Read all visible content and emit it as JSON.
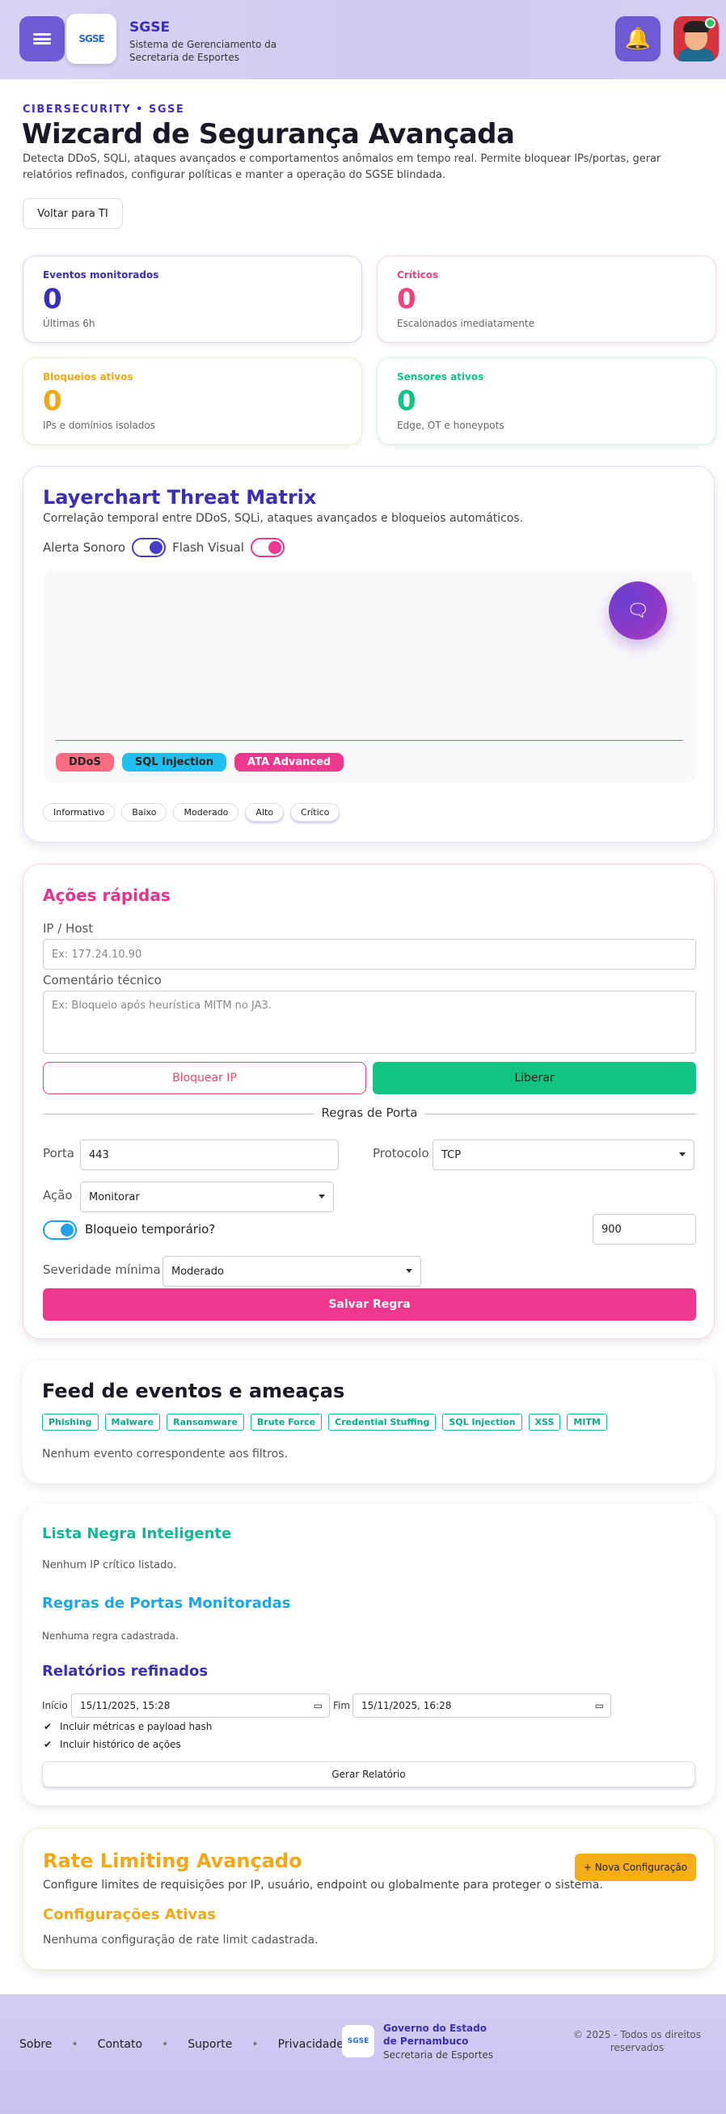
{
  "header": {
    "app_name": "SGSE",
    "app_subtitle": "Sistema de Gerenciamento da Secretaria de Esportes",
    "logo_text": "SGSE"
  },
  "hero": {
    "kicker": "CIBERSECURITY • SGSE",
    "title": "Wizcard de Segurança Avançada",
    "description": "Detecta DDoS, SQLi, ataques avançados e comportamentos anômalos em tempo real. Permite bloquear IPs/portas, gerar relatórios refinados, configurar políticas e manter a operação do SGSE blindada.",
    "back_label": "Voltar para TI"
  },
  "stats": [
    {
      "label": "Eventos monitorados",
      "value": "0",
      "sub": "Últimas 6h",
      "color": "#3b2fb8"
    },
    {
      "label": "Críticos",
      "value": "0",
      "sub": "Escalonados imediatamente",
      "color": "#f0457a"
    },
    {
      "label": "Bloqueios ativos",
      "value": "0",
      "sub": "IPs e domínios isolados",
      "color": "#f0a818"
    },
    {
      "label": "Sensores ativos",
      "value": "0",
      "sub": "Edge, OT e honeypots",
      "color": "#12c483"
    }
  ],
  "layerchart": {
    "title": "Layerchart Threat Matrix",
    "description": "Correlação temporal entre DDoS, SQLi, ataques avançados e bloqueios automáticos.",
    "alert_sound_label": "Alerta Sonoro",
    "flash_visual_label": "Flash Visual",
    "alert_sound_on": true,
    "flash_visual_on": true,
    "legend": [
      {
        "name": "DDoS",
        "color": "#ff6b81"
      },
      {
        "name": "SQL Injection",
        "color": "#1ec0f0"
      },
      {
        "name": "ATA Advanced",
        "color": "#f0378e"
      }
    ],
    "severity_filters": [
      "Informativo",
      "Baixo",
      "Moderado",
      "Alto",
      "Crítico"
    ]
  },
  "quick_actions": {
    "title": "Ações rápidas",
    "ip_label": "IP / Host",
    "ip_placeholder": "Ex: 177.24.10.90",
    "comment_label": "Comentário técnico",
    "comment_placeholder": "Ex: Bloqueio após heurística MITM no JA3.",
    "block_label": "Bloquear IP",
    "release_label": "Liberar",
    "port_rules_label": "Regras de Porta",
    "port_label": "Porta",
    "port_value": "443",
    "protocol_label": "Protocolo",
    "protocol_value": "TCP",
    "action_label": "Ação",
    "action_value": "Monitorar",
    "temp_block_label": "Bloqueio temporário?",
    "temp_block_on": true,
    "temp_block_value": "900",
    "min_severity_label": "Severidade mínima",
    "min_severity_value": "Moderado",
    "save_label": "Salvar Regra"
  },
  "feed": {
    "title": "Feed de eventos e ameaças",
    "tags": [
      "Phishing",
      "Malware",
      "Ransomware",
      "Brute Force",
      "Credential Stuffing",
      "SQL Injection",
      "XSS",
      "MITM"
    ],
    "empty": "Nenhum evento correspondente aos filtros."
  },
  "lists": {
    "blacklist_title": "Lista Negra Inteligente",
    "blacklist_empty": "Nenhum IP crítico listado.",
    "ports_title": "Regras de Portas Monitoradas",
    "ports_empty": "Nenhuma regra cadastrada.",
    "reports_title": "Relatórios refinados",
    "start_label": "Início",
    "start_value": "15/11/2025, 15:28",
    "end_label": "Fim",
    "end_value": "15/11/2025, 16:28",
    "include_metrics": "Incluir métricas e payload hash",
    "include_history": "Incluir histórico de ações",
    "generate_label": "Gerar Relatório"
  },
  "rate_limit": {
    "title": "Rate Limiting Avançado",
    "description": "Configure limites de requisições por IP, usuário, endpoint ou globalmente para proteger o sistema.",
    "new_config_label": "+ Nova Configuração",
    "active_title": "Configurações Ativas",
    "empty": "Nenhuma configuração de rate limit cadastrada."
  },
  "footer": {
    "links": [
      "Sobre",
      "Contato",
      "Suporte",
      "Privacidade"
    ],
    "org_name": "Governo do Estado de Pernambuco",
    "org_sub": "Secretaria de Esportes",
    "copyright": "© 2025 - Todos os direitos reservados"
  }
}
